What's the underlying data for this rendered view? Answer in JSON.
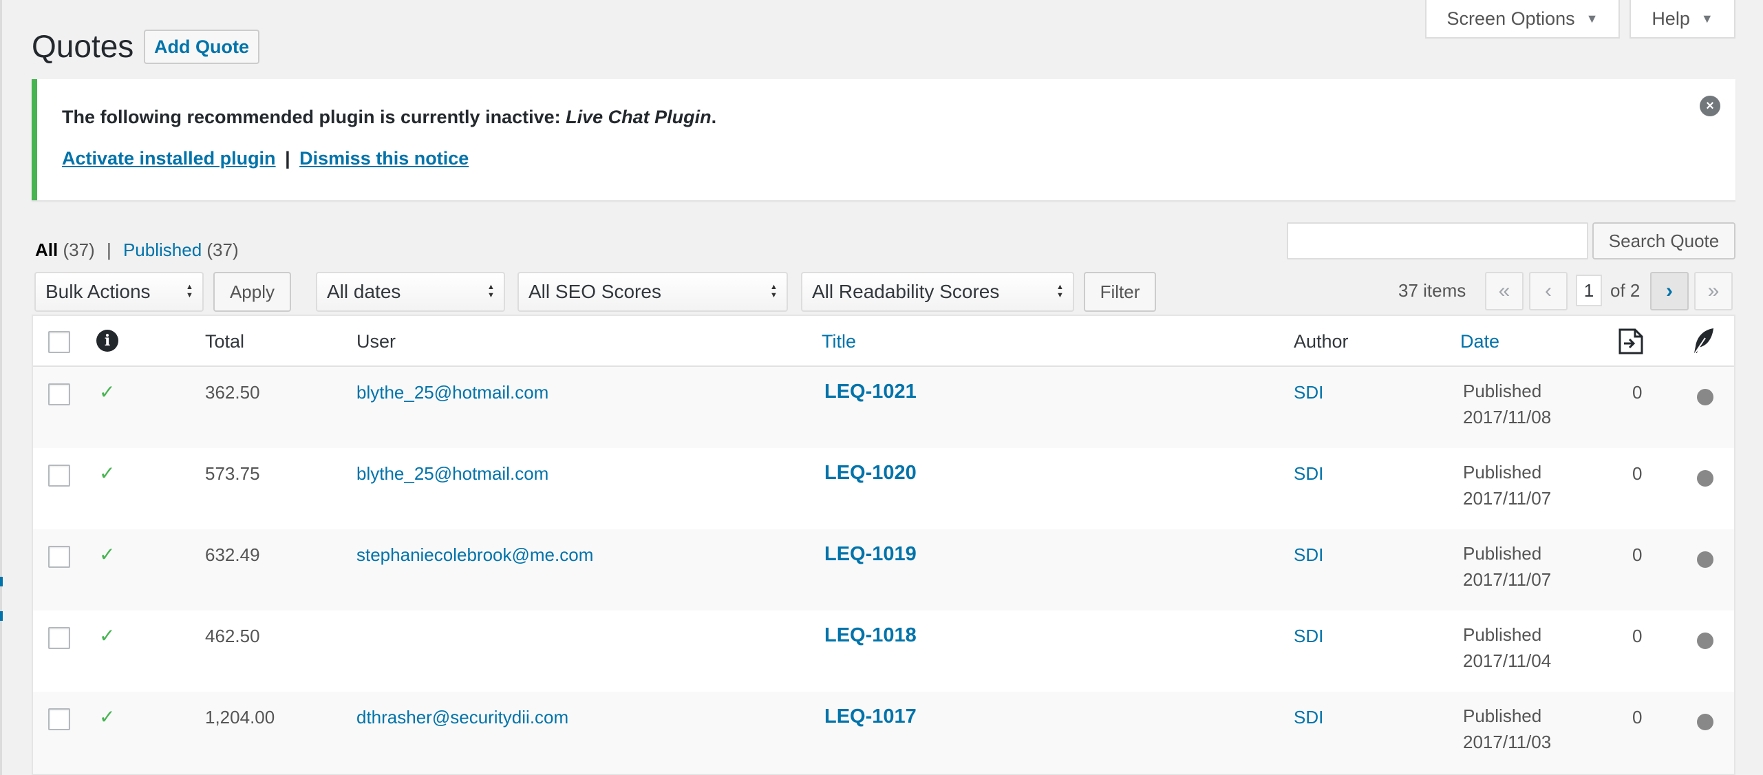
{
  "screen_meta": {
    "screen_options": "Screen Options",
    "help": "Help"
  },
  "header": {
    "title": "Quotes",
    "add_button": "Add Quote"
  },
  "notice": {
    "text_before": "The following recommended plugin is currently inactive: ",
    "plugin_name": "Live Chat Plugin",
    "text_after": ".",
    "activate_link": "Activate installed plugin",
    "separator": "|",
    "dismiss_link": "Dismiss this notice"
  },
  "views": {
    "all_label": "All",
    "all_count": "(37)",
    "sep": "|",
    "published_label": "Published",
    "published_count": "(37)"
  },
  "search": {
    "button": "Search Quote",
    "value": ""
  },
  "filters": {
    "bulk_actions": "Bulk Actions",
    "apply": "Apply",
    "dates": "All dates",
    "seo": "All SEO Scores",
    "readability": "All Readability Scores",
    "filter": "Filter"
  },
  "pagination": {
    "items": "37 items",
    "first": "«",
    "prev": "‹",
    "current_page": "1",
    "of_text": "of 2",
    "next": "›",
    "last": "»"
  },
  "table": {
    "columns": {
      "total": "Total",
      "user": "User",
      "title": "Title",
      "author": "Author",
      "date": "Date"
    },
    "rows": [
      {
        "total": "362.50",
        "user": "blythe_25@hotmail.com",
        "title": "LEQ-1021",
        "author": "SDI",
        "status": "Published",
        "date": "2017/11/08",
        "count": "0"
      },
      {
        "total": "573.75",
        "user": "blythe_25@hotmail.com",
        "title": "LEQ-1020",
        "author": "SDI",
        "status": "Published",
        "date": "2017/11/07",
        "count": "0"
      },
      {
        "total": "632.49",
        "user": "stephaniecolebrook@me.com",
        "title": "LEQ-1019",
        "author": "SDI",
        "status": "Published",
        "date": "2017/11/07",
        "count": "0"
      },
      {
        "total": "462.50",
        "user": "",
        "title": "LEQ-1018",
        "author": "SDI",
        "status": "Published",
        "date": "2017/11/04",
        "count": "0"
      },
      {
        "total": "1,204.00",
        "user": "dthrasher@securitydii.com",
        "title": "LEQ-1017",
        "author": "SDI",
        "status": "Published",
        "date": "2017/11/03",
        "count": "0"
      }
    ]
  },
  "colors": {
    "accent": "#0073aa",
    "success": "#46b450",
    "background": "#f1f1f1"
  }
}
